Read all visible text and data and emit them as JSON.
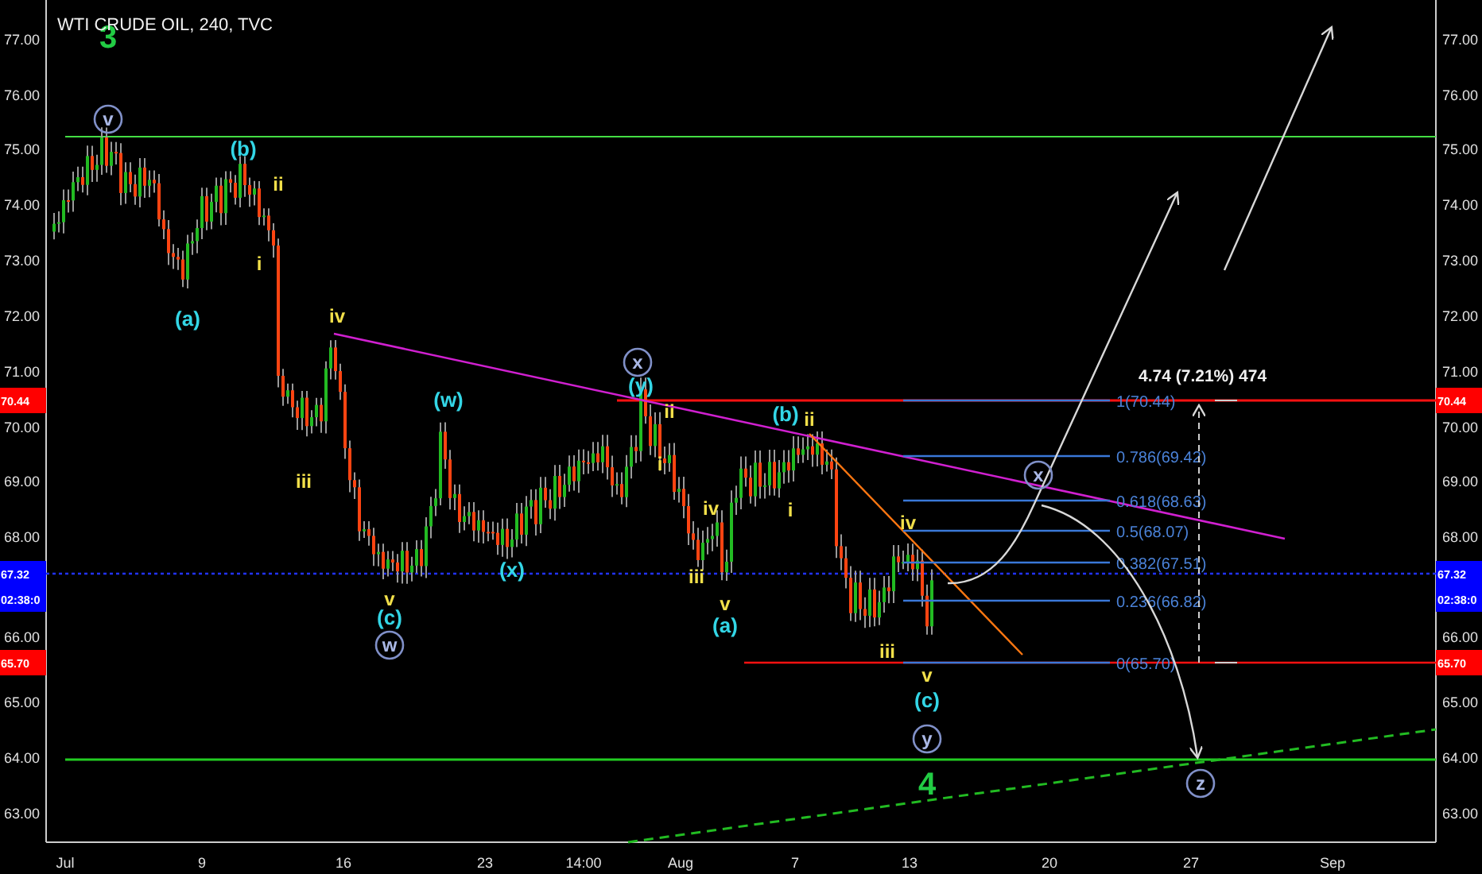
{
  "chart": {
    "title": "WTI CRUDE OIL, 240, TVC",
    "left_price_ticks": [
      "77.00",
      "76.00",
      "75.00",
      "74.00",
      "73.00",
      "72.00",
      "71.00",
      "70.00",
      "69.00",
      "68.00",
      "66.00",
      "65.00",
      "64.00",
      "63.00"
    ],
    "right_price_ticks": [
      "77.00",
      "76.00",
      "75.00",
      "74.00",
      "73.00",
      "72.00",
      "71.00",
      "70.00",
      "69.00",
      "68.00",
      "66.00",
      "65.00",
      "64.00",
      "63.00"
    ],
    "time_ticks": [
      "Jul",
      "9",
      "16",
      "23",
      "14:00",
      "Aug",
      "7",
      "13",
      "20",
      "27",
      "Sep"
    ],
    "left_badges": [
      {
        "label": "70.44",
        "color": "#ff0000"
      },
      {
        "label": "67.32",
        "color": "#0000ff"
      },
      {
        "label": "02:38:0",
        "color": "#0000ff"
      },
      {
        "label": "65.70",
        "color": "#ff0000"
      }
    ],
    "right_badges": [
      {
        "label": "70.44",
        "color": "#ff0000"
      },
      {
        "label": "67.32",
        "color": "#0000ff"
      },
      {
        "label": "02:38:0",
        "color": "#0000ff"
      },
      {
        "label": "65.70",
        "color": "#ff0000"
      }
    ],
    "wave_labels": [
      {
        "text": "3",
        "kind": "primary"
      },
      {
        "text": "v",
        "kind": "circled"
      },
      {
        "text": "(b)",
        "kind": "minor"
      },
      {
        "text": "ii",
        "kind": "minute"
      },
      {
        "text": "i",
        "kind": "minute"
      },
      {
        "text": "(a)",
        "kind": "minor"
      },
      {
        "text": "iv",
        "kind": "minute"
      },
      {
        "text": "iii",
        "kind": "minute"
      },
      {
        "text": "(w)",
        "kind": "minor"
      },
      {
        "text": "x",
        "kind": "circled"
      },
      {
        "text": "(y)",
        "kind": "minor"
      },
      {
        "text": "ii",
        "kind": "minute"
      },
      {
        "text": "i",
        "kind": "minute"
      },
      {
        "text": "(x)",
        "kind": "minor"
      },
      {
        "text": "v",
        "kind": "minute"
      },
      {
        "text": "(c)",
        "kind": "minor"
      },
      {
        "text": "w",
        "kind": "circled"
      },
      {
        "text": "iv",
        "kind": "minute"
      },
      {
        "text": "iii",
        "kind": "minute"
      },
      {
        "text": "v",
        "kind": "minute"
      },
      {
        "text": "(a)",
        "kind": "minor"
      },
      {
        "text": "(b)",
        "kind": "minor"
      },
      {
        "text": "ii",
        "kind": "minute"
      },
      {
        "text": "i",
        "kind": "minute"
      },
      {
        "text": "iv",
        "kind": "minute"
      },
      {
        "text": "iii",
        "kind": "minute"
      },
      {
        "text": "v",
        "kind": "minute"
      },
      {
        "text": "(c)",
        "kind": "minor"
      },
      {
        "text": "y",
        "kind": "circled"
      },
      {
        "text": "4",
        "kind": "primary"
      },
      {
        "text": "x",
        "kind": "circled"
      },
      {
        "text": "z",
        "kind": "circled"
      }
    ],
    "fib_levels": [
      "1(70.44)",
      "0.786(69.42)",
      "0.618(68.63)",
      "0.5(68.07)",
      "0.382(67.51)",
      "0.236(66.82)",
      "0(65.70)"
    ],
    "measure": "4.74 (7.21%) 474"
  }
}
